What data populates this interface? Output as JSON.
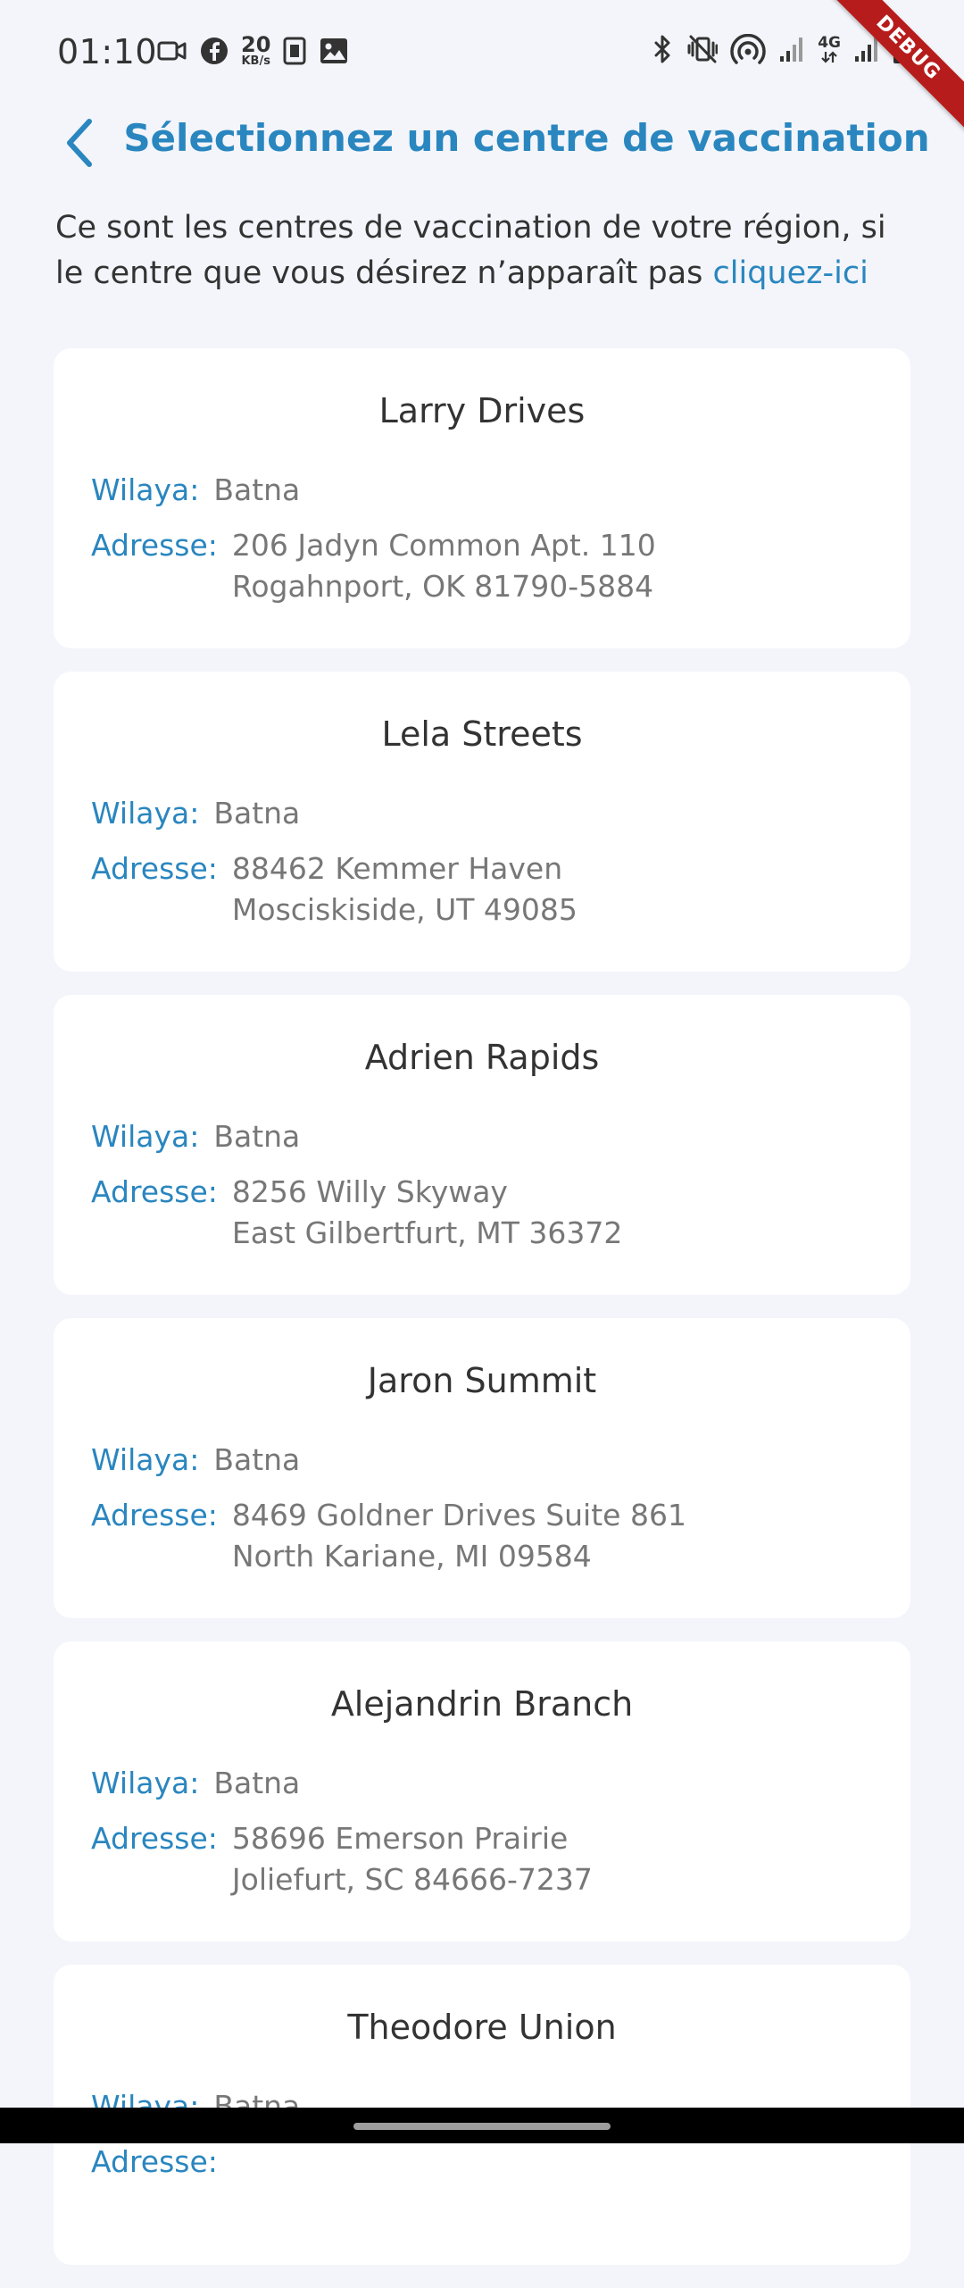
{
  "status_bar": {
    "time": "01:10",
    "data_speed_value": "20",
    "data_speed_unit": "KB/s",
    "network_type": "4G",
    "left_icons": [
      "video-camera-icon",
      "facebook-icon",
      "data-speed-indicator",
      "k-app-icon",
      "gallery-icon"
    ],
    "right_icons": [
      "bluetooth-icon",
      "vibrate-mute-icon",
      "hotspot-icon",
      "signal-icon",
      "signal-icon",
      "battery-charging-icon"
    ]
  },
  "debug_banner": "DEBUG",
  "header": {
    "back_icon": "chevron-left-icon",
    "title": "Sélectionnez un centre de vaccination"
  },
  "intro": {
    "text": "Ce sont les centres de vaccination de votre région, si le centre que vous désirez n’apparaît pas ",
    "link": "cliquez-ici"
  },
  "labels": {
    "wilaya": "Wilaya:",
    "adresse": "Adresse:"
  },
  "centers": [
    {
      "name": "Larry Drives",
      "wilaya": "Batna",
      "address_line1": "206 Jadyn Common Apt. 110",
      "address_line2": "Rogahnport, OK 81790-5884"
    },
    {
      "name": "Lela Streets",
      "wilaya": "Batna",
      "address_line1": "88462 Kemmer Haven",
      "address_line2": "Mosciskiside, UT 49085"
    },
    {
      "name": "Adrien Rapids",
      "wilaya": "Batna",
      "address_line1": "8256 Willy Skyway",
      "address_line2": "East Gilbertfurt, MT 36372"
    },
    {
      "name": "Jaron Summit",
      "wilaya": "Batna",
      "address_line1": "8469 Goldner Drives Suite 861",
      "address_line2": "North Kariane, MI 09584"
    },
    {
      "name": "Alejandrin Branch",
      "wilaya": "Batna",
      "address_line1": "58696 Emerson Prairie",
      "address_line2": "Joliefurt, SC 84666-7237"
    },
    {
      "name": "Theodore Union",
      "wilaya": "Batna",
      "address_line1": "",
      "address_line2": ""
    }
  ],
  "colors": {
    "accent": "#2a86bf",
    "background": "#f3f5fa",
    "card": "#ffffff",
    "text_primary": "#333333",
    "text_secondary": "#777777",
    "debug_ribbon": "#b71c1c"
  }
}
